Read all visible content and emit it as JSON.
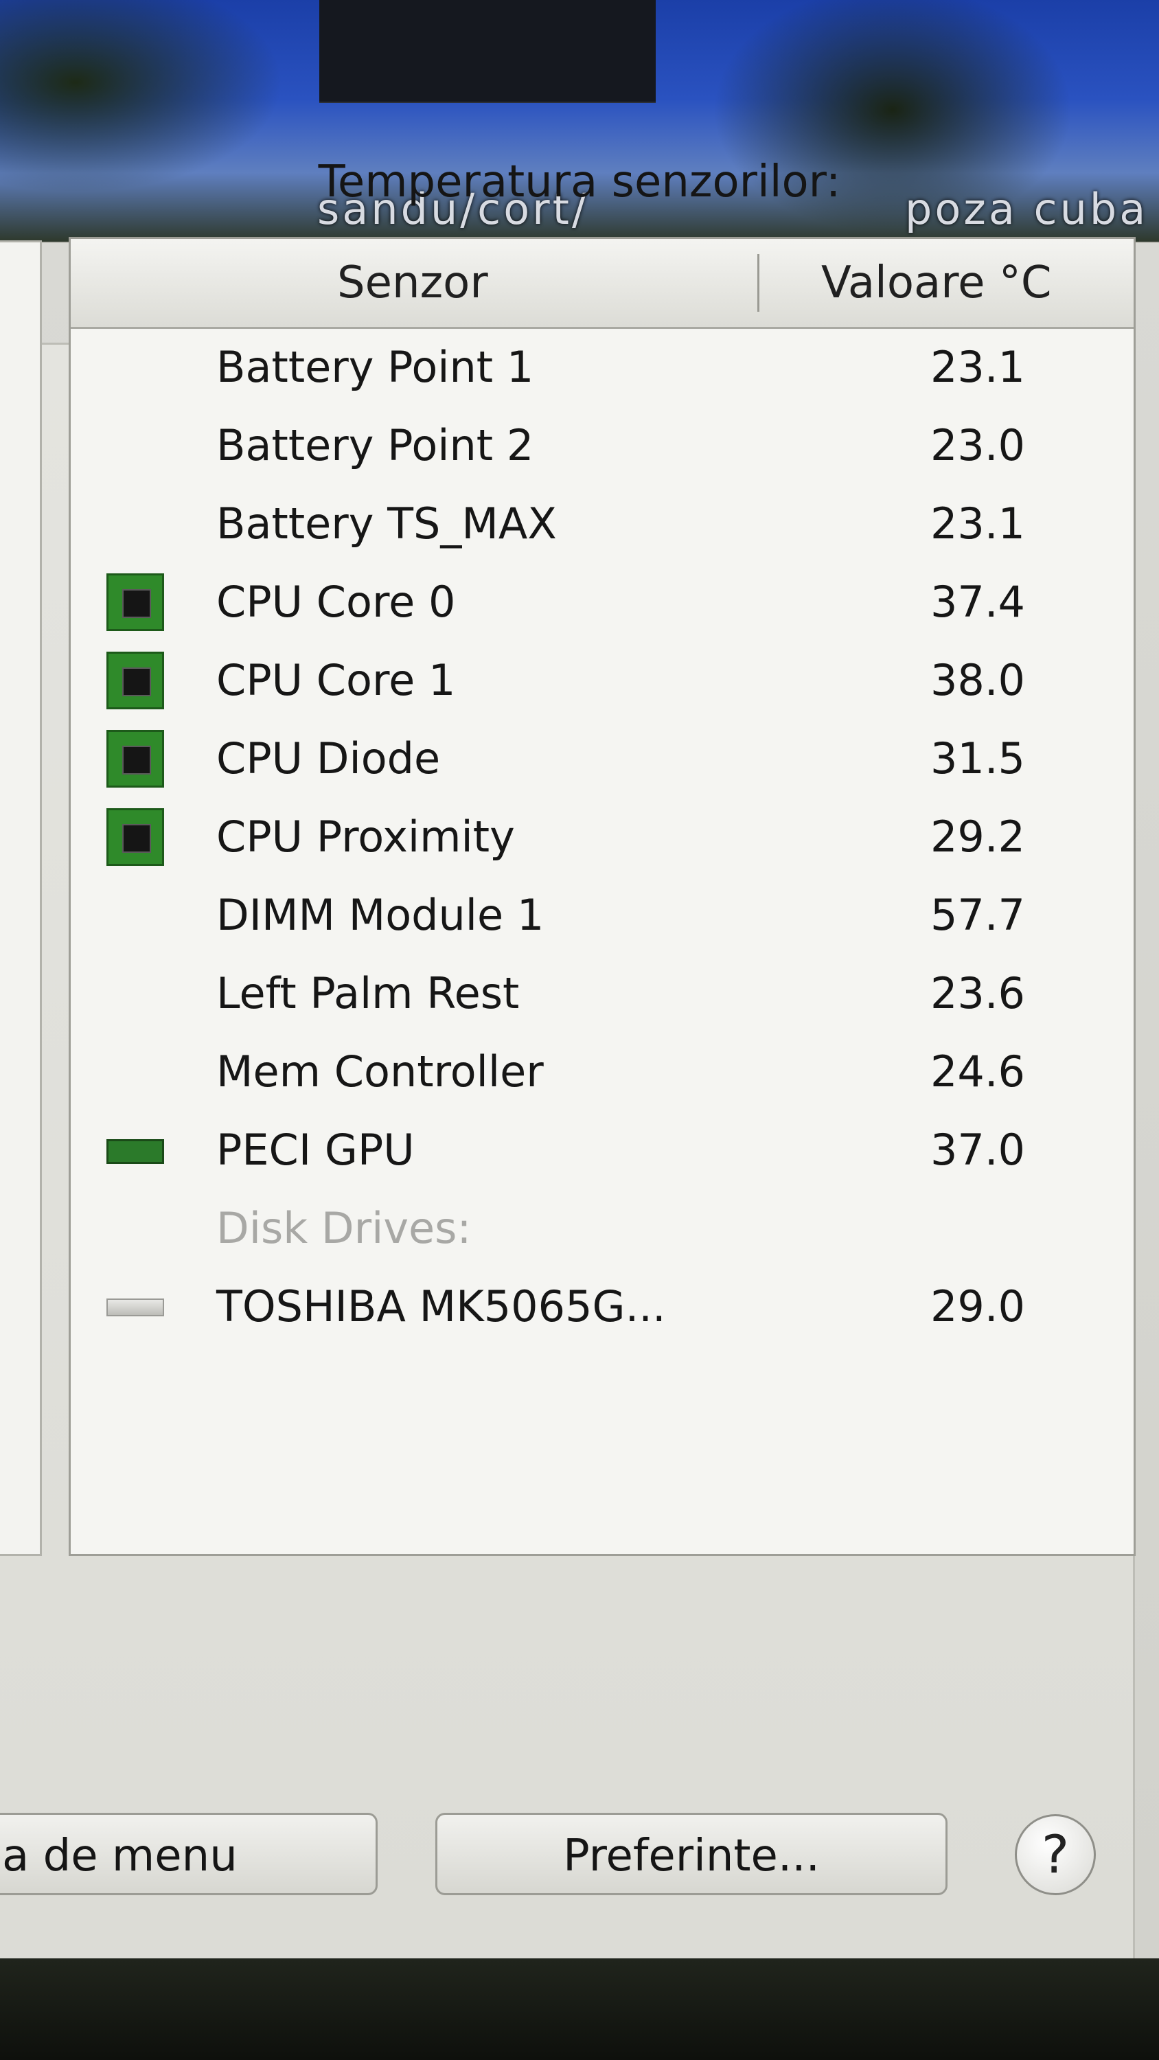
{
  "desktop": {
    "labels": [
      "sandu/cort/",
      "poza cuba"
    ]
  },
  "panel": {
    "title": "Temperatura senzorilor:",
    "columns": {
      "sensor": "Senzor",
      "value": "Valoare °C"
    },
    "rows": [
      {
        "icon": "",
        "name": "Battery Point 1",
        "value": "23.1"
      },
      {
        "icon": "",
        "name": "Battery Point 2",
        "value": "23.0"
      },
      {
        "icon": "",
        "name": "Battery TS_MAX",
        "value": "23.1"
      },
      {
        "icon": "cpu-chip-icon",
        "name": "CPU Core 0",
        "value": "37.4"
      },
      {
        "icon": "cpu-chip-icon",
        "name": "CPU Core 1",
        "value": "38.0"
      },
      {
        "icon": "cpu-chip-icon",
        "name": "CPU Diode",
        "value": "31.5"
      },
      {
        "icon": "cpu-chip-icon",
        "name": "CPU Proximity",
        "value": "29.2"
      },
      {
        "icon": "",
        "name": "DIMM Module 1",
        "value": "57.7"
      },
      {
        "icon": "",
        "name": "Left Palm Rest",
        "value": "23.6"
      },
      {
        "icon": "",
        "name": "Mem Controller",
        "value": "24.6"
      },
      {
        "icon": "gpu-card-icon",
        "name": "PECI GPU",
        "value": "37.0"
      },
      {
        "icon": "",
        "name": "Disk Drives:",
        "value": "",
        "section": true
      },
      {
        "icon": "hard-disk-icon",
        "name": "TOSHIBA MK5065G...",
        "value": "29.0"
      }
    ]
  },
  "buttons": {
    "menu": "a de menu",
    "preferences": "Preferinte...",
    "help": "?"
  }
}
